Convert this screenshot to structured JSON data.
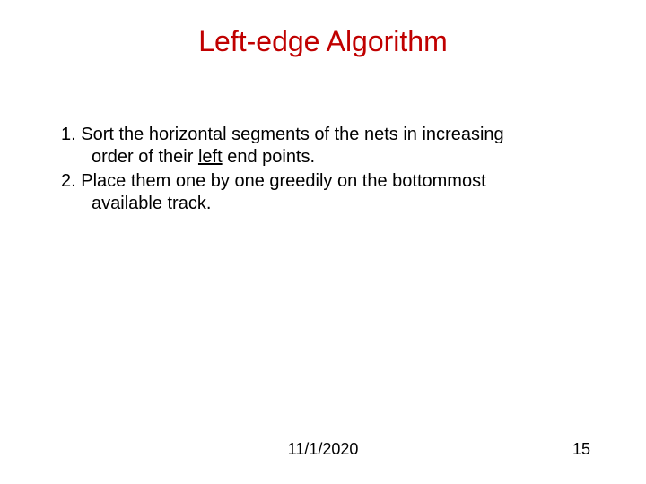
{
  "title": "Left-edge Algorithm",
  "items": [
    {
      "num": "1.",
      "first": "Sort the horizontal segments of the nets in increasing",
      "cont_pre": "order of their ",
      "cont_underlined": "left",
      "cont_post": " end points."
    },
    {
      "num": "2.",
      "first": "Place them one by one greedily on the bottommost",
      "cont_pre": "available track.",
      "cont_underlined": "",
      "cont_post": ""
    }
  ],
  "footer": {
    "date": "11/1/2020",
    "page": "15"
  }
}
